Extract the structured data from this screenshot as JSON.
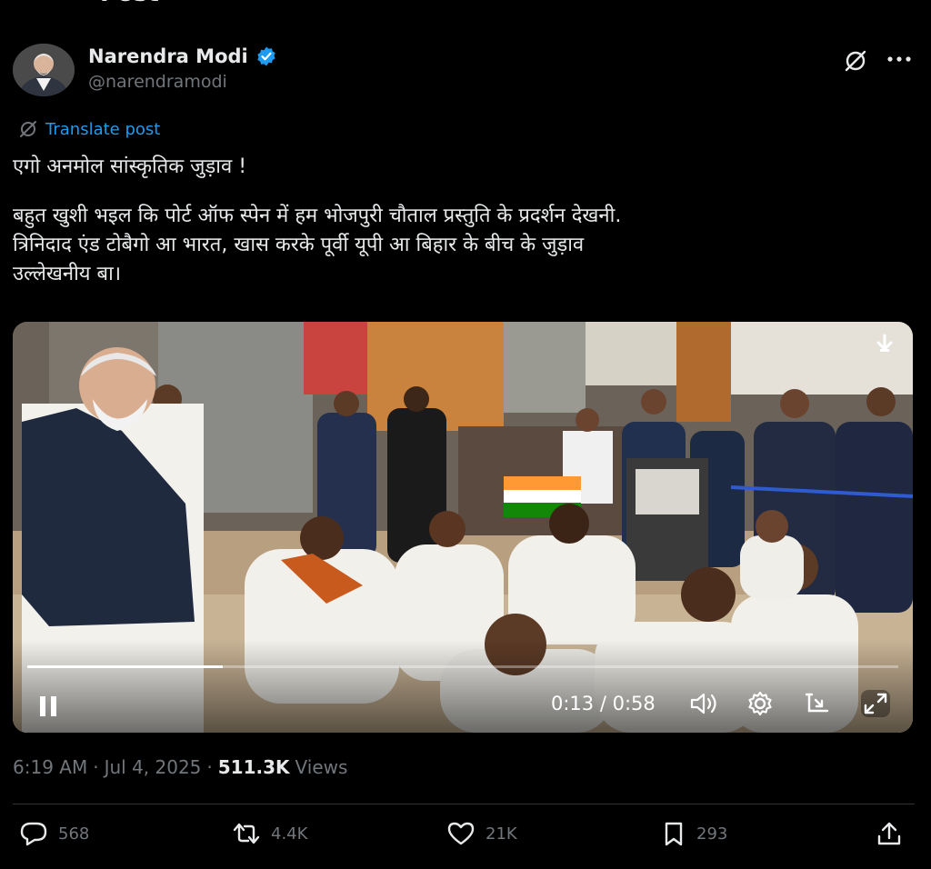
{
  "header": {
    "title": "Post"
  },
  "author": {
    "display_name": "Narendra Modi",
    "handle": "@narendramodi",
    "verified": true
  },
  "translate": {
    "label": "Translate post"
  },
  "post": {
    "line1": "एगो अनमोल सांस्कृतिक जुड़ाव !",
    "line2": "बहुत खुशी भइल कि पोर्ट ऑफ स्पेन में हम भोजपुरी चौताल प्रस्तुति के प्रदर्शन देखनी.",
    "line3": "त्रिनिदाद एंड टोबैगो आ भारत, खास करके पूर्वी यूपी आ बिहार के बीच के जुड़ाव",
    "line4": "उल्लेखनीय बा।"
  },
  "video": {
    "current_time": "0:13",
    "separator": " / ",
    "duration": "0:58",
    "progress_fraction": 0.224,
    "state": "playing"
  },
  "meta": {
    "time": "6:19 AM",
    "date": "Jul 4, 2025",
    "dot": "·",
    "views_count": "511.3K",
    "views_label": "Views"
  },
  "actions": {
    "replies": "568",
    "reposts": "4.4K",
    "likes": "21K",
    "bookmarks": "293"
  },
  "colors": {
    "background": "#000000",
    "text": "#e7e9ea",
    "secondary": "#71767b",
    "accent": "#1d9bf0",
    "verified": "#1d9bf0"
  }
}
